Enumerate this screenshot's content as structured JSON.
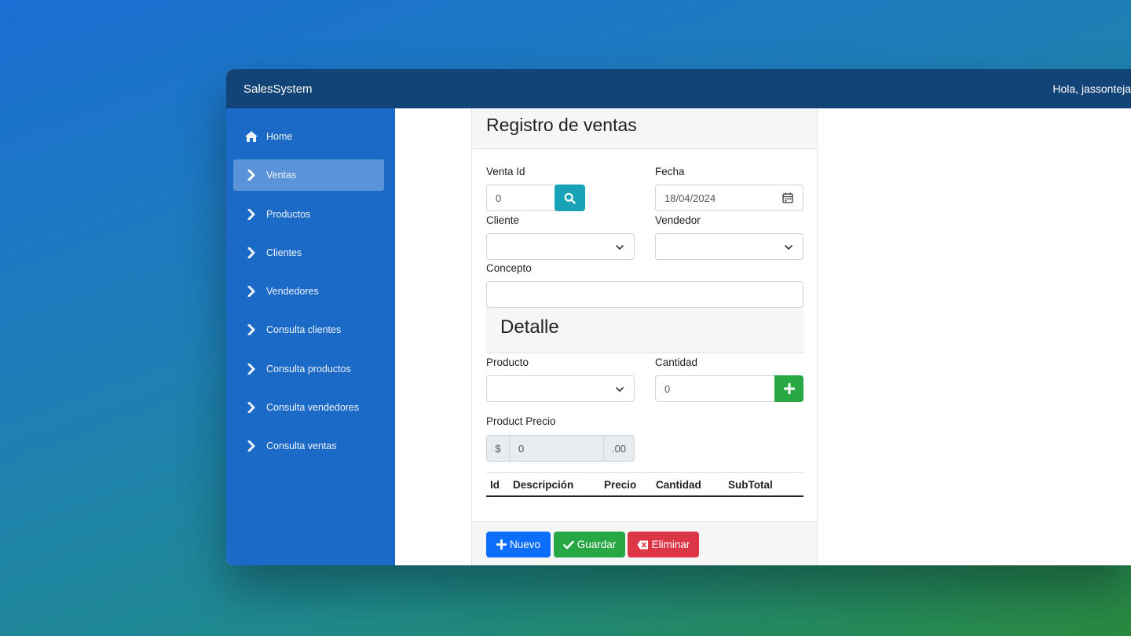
{
  "header": {
    "brand": "SalesSystem",
    "greeting": "Hola, jassonteja"
  },
  "sidebar": {
    "items": [
      {
        "label": "Home",
        "icon": "home-icon",
        "active": false
      },
      {
        "label": "Ventas",
        "icon": "chevron-right-icon",
        "active": true
      },
      {
        "label": "Productos",
        "icon": "chevron-right-icon",
        "active": false
      },
      {
        "label": "Clientes",
        "icon": "chevron-right-icon",
        "active": false
      },
      {
        "label": "Vendedores",
        "icon": "chevron-right-icon",
        "active": false
      },
      {
        "label": "Consulta clientes",
        "icon": "chevron-right-icon",
        "active": false
      },
      {
        "label": "Consulta productos",
        "icon": "chevron-right-icon",
        "active": false
      },
      {
        "label": "Consulta vendedores",
        "icon": "chevron-right-icon",
        "active": false
      },
      {
        "label": "Consulta ventas",
        "icon": "chevron-right-icon",
        "active": false
      }
    ]
  },
  "form": {
    "title": "Registro de ventas",
    "venta_id": {
      "label": "Venta Id",
      "value": "0"
    },
    "fecha": {
      "label": "Fecha",
      "value": "18/04/2024"
    },
    "cliente": {
      "label": "Cliente",
      "value": ""
    },
    "vendedor": {
      "label": "Vendedor",
      "value": ""
    },
    "concepto": {
      "label": "Concepto",
      "value": ""
    },
    "detalle_title": "Detalle",
    "producto": {
      "label": "Producto",
      "value": ""
    },
    "cantidad": {
      "label": "Cantidad",
      "value": "0"
    },
    "precio": {
      "label": "Product Precio",
      "prefix": "$",
      "value": "0",
      "suffix": ".00"
    }
  },
  "table": {
    "columns": [
      "Id",
      "Descripción",
      "Precio",
      "Cantidad",
      "SubTotal"
    ],
    "rows": []
  },
  "footer": {
    "nuevo": "Nuevo",
    "guardar": "Guardar",
    "eliminar": "Eliminar"
  },
  "colors": {
    "topbar": "#134478",
    "sidebar": "#1c6ac8",
    "active_item": "#5b93d8",
    "info": "#17a2b8",
    "success": "#28a745",
    "primary": "#0d6efd",
    "danger": "#dc3545"
  }
}
